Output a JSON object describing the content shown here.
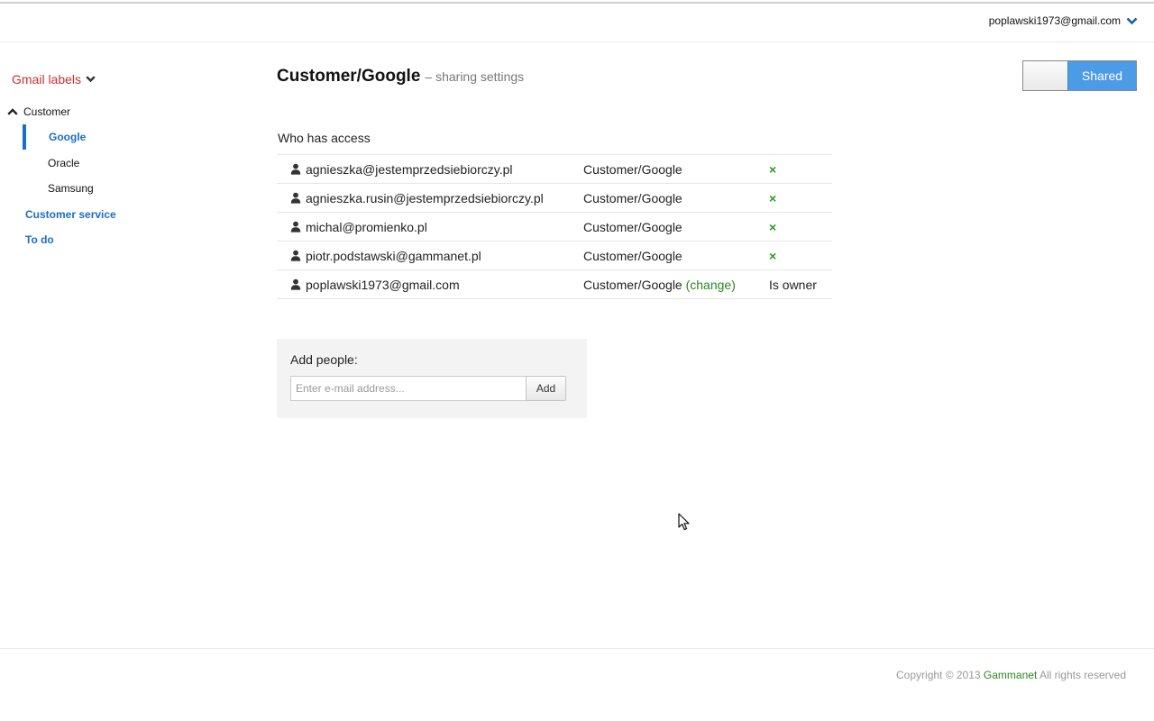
{
  "header": {
    "account_email": "poplawski1973@gmail.com"
  },
  "sidebar": {
    "labels_title": "Gmail labels",
    "tree": {
      "parent": "Customer",
      "children": [
        "Google",
        "Oracle",
        "Samsung"
      ],
      "other": [
        "Customer service",
        "To do"
      ]
    }
  },
  "main": {
    "title": "Customer/Google",
    "subtitle": "– sharing settings",
    "toggle": {
      "state": "Shared"
    },
    "access_heading": "Who has access",
    "rows": [
      {
        "email": "agnieszka@jestemprzedsiebiorczy.pl",
        "label": "Customer/Google",
        "action": "×"
      },
      {
        "email": "agnieszka.rusin@jestemprzedsiebiorczy.pl",
        "label": "Customer/Google",
        "action": "×"
      },
      {
        "email": "michal@promienko.pl",
        "label": "Customer/Google",
        "action": "×"
      },
      {
        "email": "piotr.podstawski@gammanet.pl",
        "label": "Customer/Google",
        "action": "×"
      },
      {
        "email": "poplawski1973@gmail.com",
        "label": "Customer/Google",
        "change": "(change)",
        "action": "Is owner"
      }
    ],
    "add_people": {
      "label": "Add people:",
      "placeholder": "Enter e-mail address...",
      "button": "Add"
    }
  },
  "footer": {
    "prefix": "Copyright © 2013",
    "brand": "Gammanet",
    "suffix": "All rights reserved"
  },
  "colors": {
    "accent_blue": "#1a6fc4",
    "toggle_blue": "#4b9be6",
    "label_red": "#c8322c",
    "action_green": "#2a9a22"
  }
}
